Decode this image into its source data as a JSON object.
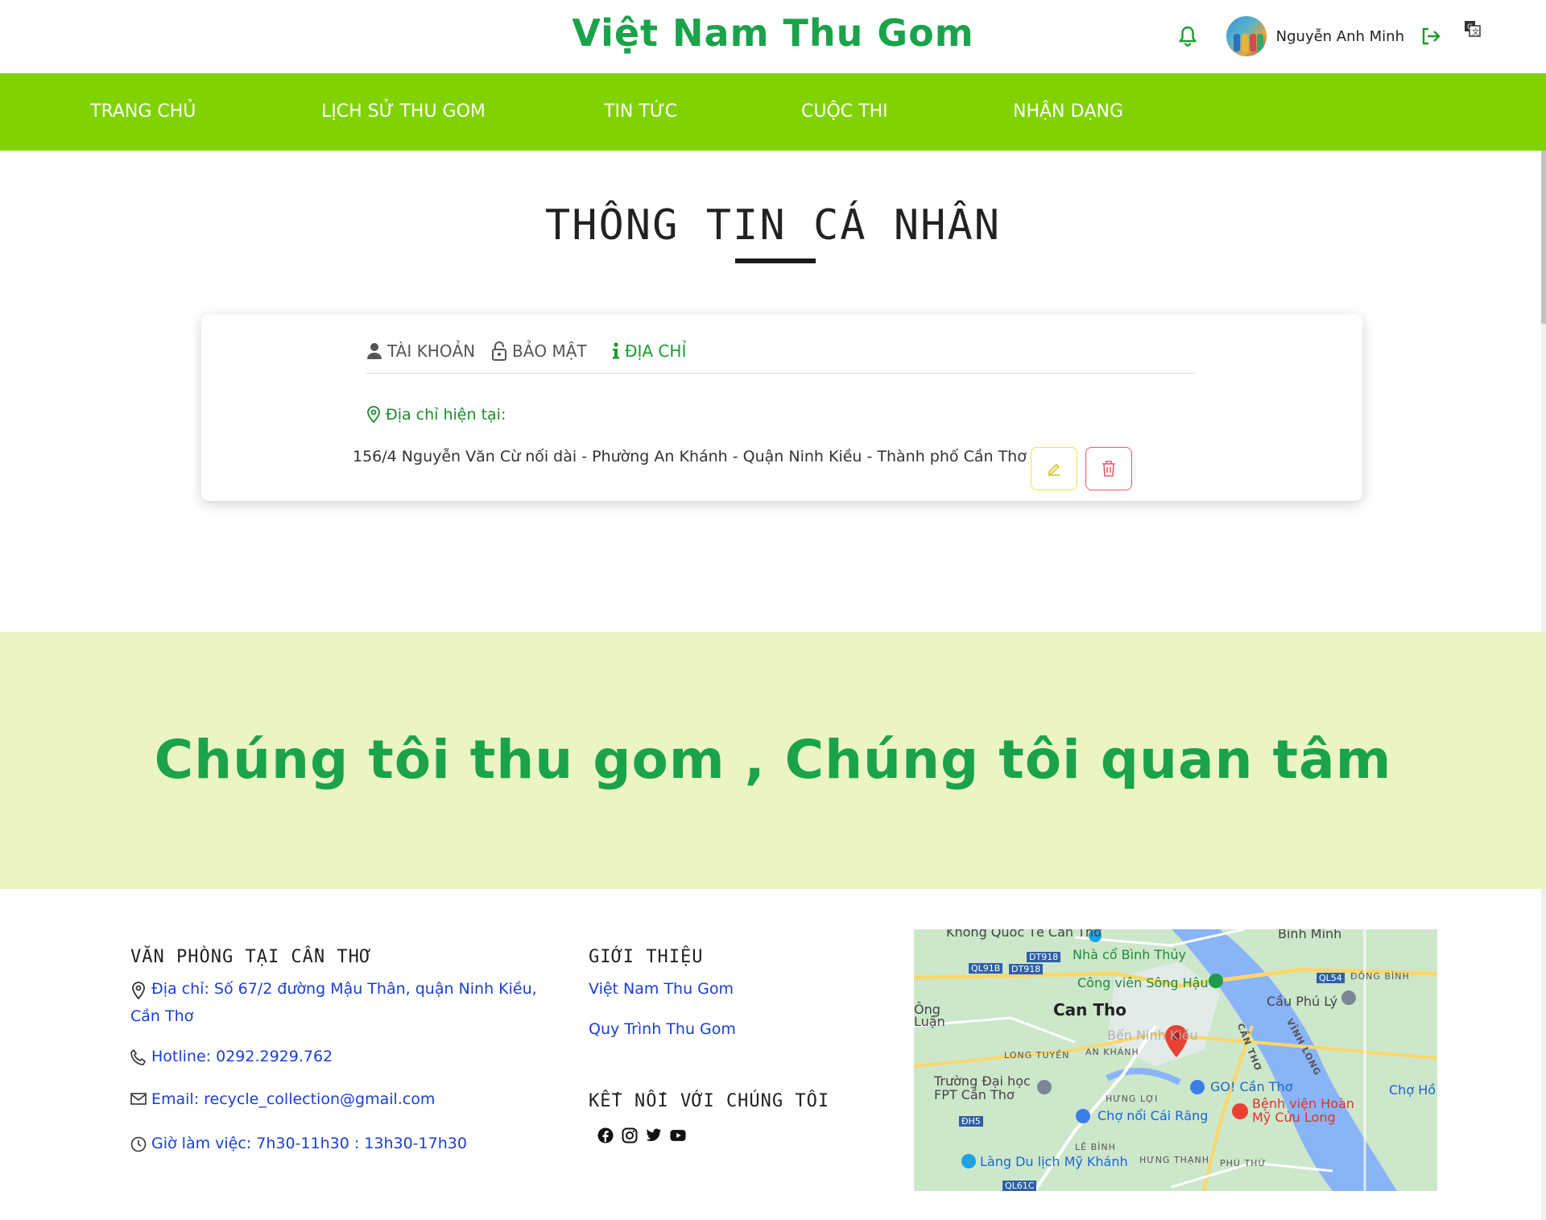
{
  "header": {
    "brand": "Việt Nam Thu Gom",
    "username": "Nguyễn Anh Minh",
    "icons": [
      "bell-icon",
      "avatar",
      "logout-icon",
      "translate-icon"
    ],
    "brand_color": "#1aa34a"
  },
  "nav": {
    "background": "#80d200",
    "items": [
      {
        "label": "TRANG CHỦ"
      },
      {
        "label": "LỊCH SỬ THU GOM"
      },
      {
        "label": "TIN TỨC"
      },
      {
        "label": "CUỘC THI"
      },
      {
        "label": "NHẬN DẠNG"
      }
    ]
  },
  "page": {
    "title": "THÔNG TIN CÁ NHÂN"
  },
  "profile_card": {
    "tabs": [
      {
        "label": "TÀI KHOẢN",
        "icon": "user-icon",
        "active": false
      },
      {
        "label": "BẢO MẬT",
        "icon": "lock-icon",
        "active": false
      },
      {
        "label": "ĐỊA CHỈ",
        "icon": "info-icon",
        "active": true
      }
    ],
    "address_label": "Địa chỉ hiện tại:",
    "address_value": "156/4 Nguyễn Văn Cừ nối dài - Phường An Khánh - Quận Ninh Kiều - Thành phố Cần Thơ",
    "actions": [
      "edit-icon",
      "trash-icon"
    ]
  },
  "banner": {
    "slogan": "Chúng tôi thu gom , Chúng tôi quan tâm",
    "background": "#ebf5c4"
  },
  "footer": {
    "office": {
      "heading": "VĂN PHÒNG TẠI CẦN THƠ",
      "address_line1": "Địa chỉ: Số 67/2 đường Mậu Thân, quận Ninh Kiều,",
      "address_line2": "Cần Thơ",
      "hotline": "Hotline: 0292.2929.762",
      "email": "Email: recycle_collection@gmail.com",
      "hours": "Giờ làm việc: 7h30-11h30 : 13h30-17h30"
    },
    "about": {
      "heading": "GIỚI THIỆU",
      "links": [
        "Việt Nam Thu Gom",
        "Quy Trình Thu Gom"
      ]
    },
    "connect": {
      "heading": "KẾT NỐI VỚI CHÚNG TÔI",
      "socials": [
        "facebook-icon",
        "instagram-icon",
        "twitter-icon",
        "youtube-icon"
      ]
    },
    "map": {
      "labels": {
        "city": "Can Tho",
        "park": "Công viên Sông Hậu",
        "house": "Nhà cổ Bình Thủy",
        "intl": "Không Quốc Tế Cần Thơ",
        "binh_minh": "Bình Minh",
        "dong_binh": "ĐÔNG BÌNH",
        "cau_phu_ly": "Cầu Phú Lý",
        "vinh_long": "VĨNH LONG",
        "can_tho_river": "CẦN THƠ",
        "ben_ninh_kieu": "Bến Ninh Kiều",
        "an_khanh": "AN KHÁNH",
        "long_tuyen": "LONG TUYỀN",
        "fpt": "Trường Đại học FPT Cần Thơ",
        "go": "GO! Cần Thơ",
        "hung_loi": "HƯNG LỢI",
        "cho_noi": "Chợ nổi Cái Răng",
        "benh_vien": "Bệnh viện Hoàn Mỹ Cửu Long",
        "cho_ho": "Chợ Hồ",
        "le_binh": "LÊ BÌNH",
        "lang_du_lich": "Làng Du lịch Mỹ Khánh",
        "hung_thanh": "HƯNG THẠNH",
        "phu_thu": "PHÚ THỨ",
        "ong_luan": "Ông Luận",
        "road_dt918a": "DT918",
        "road_ql91b": "QL91B",
        "road_dt918b": "DT918",
        "road_ql54": "QL54",
        "road_dh5": "ĐH5",
        "road_ql61c": "QL61C"
      }
    }
  }
}
